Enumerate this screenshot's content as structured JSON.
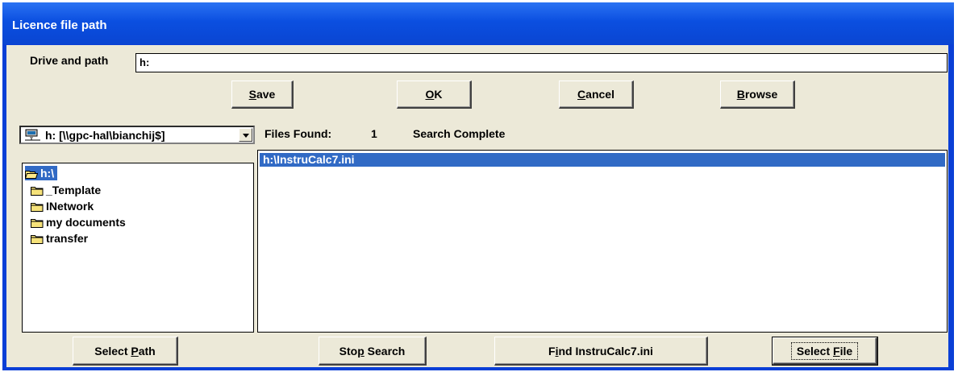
{
  "window": {
    "title": "Licence file path"
  },
  "drive_path": {
    "label": "Drive and path",
    "value": "h:"
  },
  "top_buttons": {
    "save": "Save",
    "ok": "OK",
    "cancel": "Cancel",
    "browse": "Browse"
  },
  "drive_combo": {
    "selected": "h: [\\\\gpc-hal\\bianchij$]",
    "icon": "network-drive-icon"
  },
  "status": {
    "files_found_label": "Files Found:",
    "files_found_count": "1",
    "search_status": "Search Complete"
  },
  "directory_tree": {
    "items": [
      {
        "label": "h:\\",
        "icon": "open-folder-icon",
        "selected": true
      },
      {
        "label": "_Template",
        "icon": "folder-icon"
      },
      {
        "label": "INetwork",
        "icon": "folder-icon"
      },
      {
        "label": "my documents",
        "icon": "folder-icon"
      },
      {
        "label": "transfer",
        "icon": "folder-icon"
      }
    ]
  },
  "files": [
    {
      "label": "h:\\InstruCalc7.ini",
      "selected": true
    }
  ],
  "bottom_buttons": {
    "select_path": "Select Path",
    "stop_search": "Stop Search",
    "find": "Find InstruCalc7.ini",
    "select_file": "Select File"
  },
  "colors": {
    "titlebar": "#0a4fe0",
    "selection": "#316ac5",
    "face": "#ece9d8"
  }
}
